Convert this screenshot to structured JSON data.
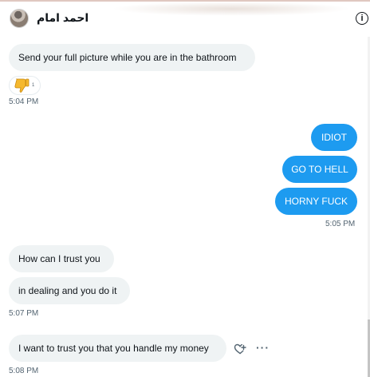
{
  "header": {
    "contact_name": "احمد امام",
    "info_icon_glyph": "i",
    "avatar_icon": "avatar-photo"
  },
  "messages": [
    {
      "id": "m1",
      "direction": "incoming",
      "text": "Send your full picture while you are in the bathroom"
    },
    {
      "id": "m2",
      "direction": "outgoing",
      "text": "IDIOT"
    },
    {
      "id": "m3",
      "direction": "outgoing",
      "text": "GO TO HELL"
    },
    {
      "id": "m4",
      "direction": "outgoing",
      "text": "HORNY FUCK"
    },
    {
      "id": "m5",
      "direction": "incoming",
      "text": "How can I trust you"
    },
    {
      "id": "m6",
      "direction": "incoming",
      "text": "in dealing and you do it"
    },
    {
      "id": "m7",
      "direction": "incoming",
      "text": "I want to trust you that you handle my money"
    }
  ],
  "reaction": {
    "emoji_icon": "thumbs-down-emoji",
    "count": "1"
  },
  "timestamps": {
    "t1": "5:04 PM",
    "t2": "5:05 PM",
    "t3": "5:07 PM",
    "t4": "5:08 PM"
  },
  "message_actions": {
    "react_icon": "heart-plus-icon",
    "more_glyph": "···"
  },
  "colors": {
    "outgoing_bubble": "#1d9bf0",
    "incoming_bubble": "#eff3f4",
    "timestamp": "#536471",
    "reaction_emoji": "#f5b82e"
  }
}
